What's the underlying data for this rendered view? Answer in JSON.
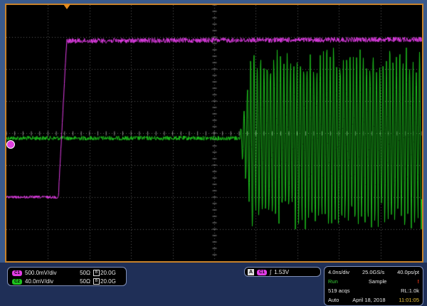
{
  "colors": {
    "ch1": "#e23de6",
    "ch2": "#1ec41e",
    "grid": "#5f5f5f",
    "frame": "#c8822a",
    "run": "#3ad13a"
  },
  "channels": [
    {
      "badge": "C1",
      "scale": "500.0mV/div",
      "impedance": "50Ω",
      "bandwidth": "20.0G",
      "bw_icon": "bandwidth-limit-icon"
    },
    {
      "badge": "C2",
      "scale": "40.0mV/div",
      "impedance": "50Ω",
      "bandwidth": "20.0G",
      "bw_icon": "bandwidth-limit-icon"
    }
  ],
  "trigger": {
    "badge": "A",
    "source": "C1",
    "slope_icon": "rising-edge-icon",
    "slope_glyph": "∫",
    "level": "1.53V"
  },
  "acquisition": {
    "timebase": "4.0ns/div",
    "sample_rate": "25.0GS/s",
    "resolution": "40.0ps/pt",
    "state": "Run",
    "mode": "Sample",
    "acqs": "519 acqs",
    "record_length": "RL:1.0k",
    "trigger_mode": "Auto",
    "date": "April 18, 2018",
    "time": "11:01:05",
    "alert_glyph": "!"
  },
  "waveforms": {
    "ch1_level_before": 0.25,
    "ch1_level_after": 0.86,
    "ch1_rise_start_frac": 0.125,
    "ch1_rise_end_frac": 0.145,
    "ch2_center": 0.48,
    "ch2_burst_start_frac": 0.56,
    "ch2_burst_amplitude": 0.33
  }
}
